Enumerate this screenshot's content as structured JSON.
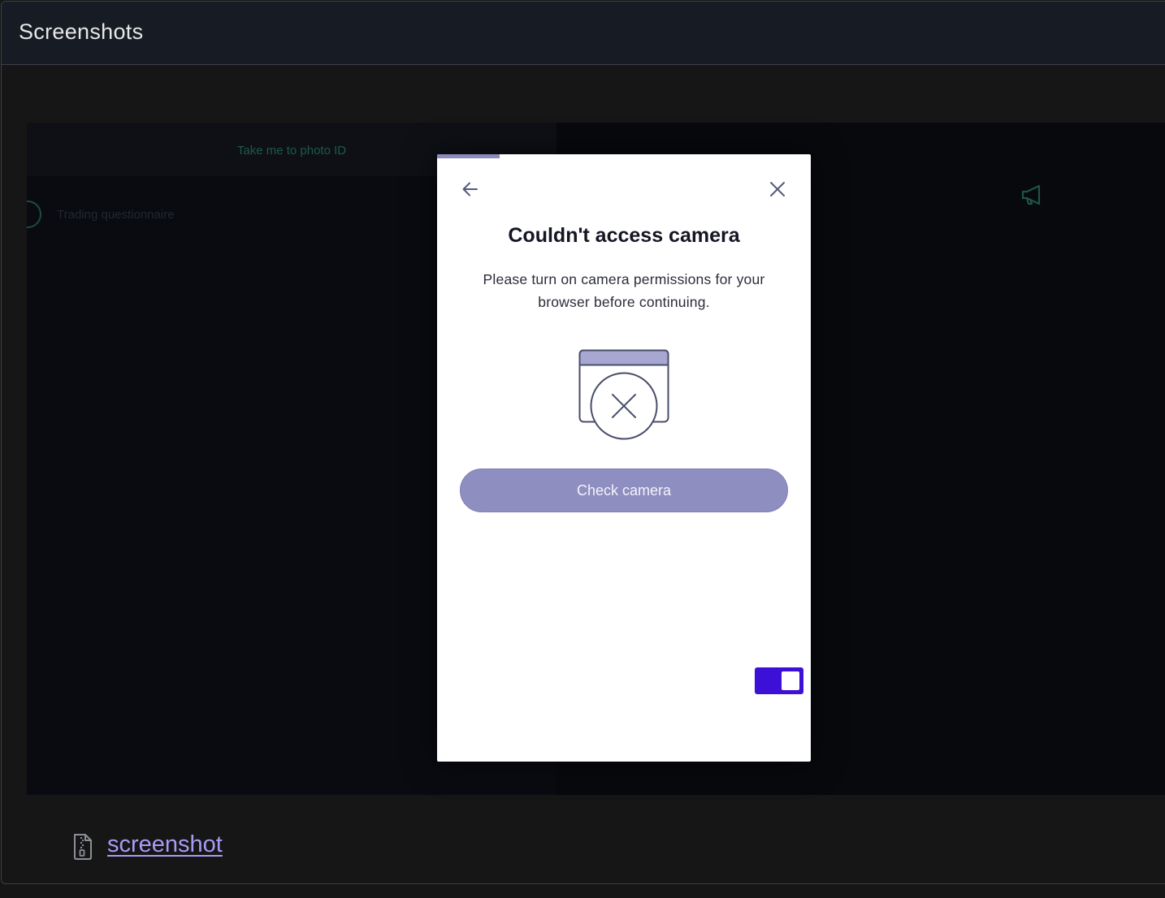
{
  "panel": {
    "title": "Screenshots"
  },
  "background_app": {
    "cta_label": "Take me to photo ID",
    "step_label": "Trading questionnaire"
  },
  "modal": {
    "progress": 0.167,
    "title": "Couldn't access camera",
    "description": "Please turn on camera permissions for your browser before continuing.",
    "button_label": "Check camera",
    "toggle_on": true,
    "icons": {
      "back": "arrow-left-icon",
      "close": "close-icon",
      "illustration": "camera-blocked-illustration"
    }
  },
  "footer": {
    "link_label": "screenshot",
    "icon": "zip-file-icon"
  },
  "colors": {
    "progress": "#8c8bbd",
    "button": "#8e8ec0",
    "toggle": "#3d10d8",
    "link": "#a79cf4"
  }
}
